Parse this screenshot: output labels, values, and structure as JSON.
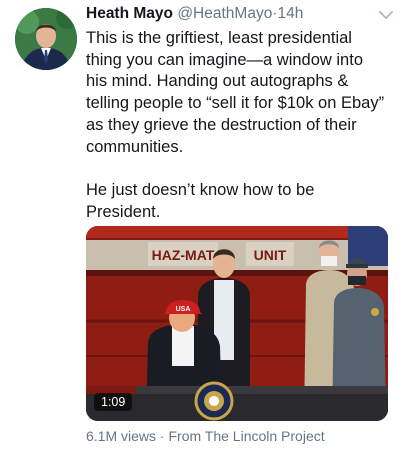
{
  "tweet": {
    "author_name": "Heath Mayo",
    "handle": "@HeathMayo",
    "separator": "·",
    "time": "14h",
    "text": "This is the griftiest, least presidential thing you can imagine—a window into his mind. Handing out autographs & telling people to “sell it for $10k on Ebay” as they grieve the destruction of their communities.\n\nHe just doesn’t know how to be President.",
    "media": {
      "duration": "1:09",
      "truck_sign_left": "HAZ-MAT",
      "truck_sign_right": "UNIT",
      "hat_text": "USA"
    },
    "views": "6.1M views",
    "source": "From The Lincoln Project"
  },
  "colors": {
    "text": "#14171a",
    "secondary": "#657786",
    "truck_red": "#8f1d14"
  },
  "icons": {
    "menu": "chevron-down-icon",
    "play_badge": "video-duration"
  }
}
